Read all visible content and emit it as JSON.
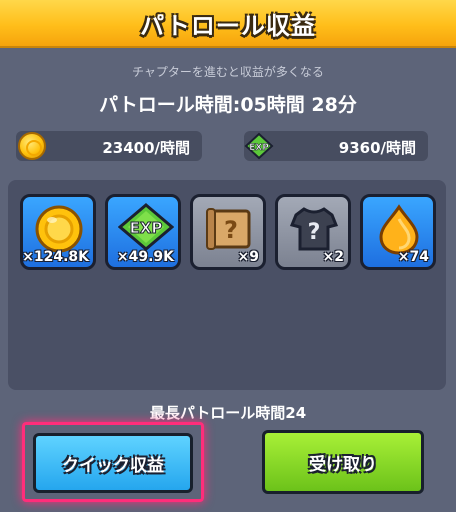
{
  "header": {
    "title": "パトロール収益"
  },
  "hint": "チャプターを進むと収益が多くなる",
  "patrol_time": "パトロール時間:05時間 28分",
  "rates": {
    "gold": "23400/時間",
    "exp": "9360/時間"
  },
  "rewards": [
    {
      "icon": "gold-coin-icon",
      "count": "×124.8K"
    },
    {
      "icon": "exp-gem-icon",
      "count": "×49.9K",
      "badge": "EXP"
    },
    {
      "icon": "mystery-scroll-icon",
      "count": "×9"
    },
    {
      "icon": "mystery-shirt-icon",
      "count": "×2"
    },
    {
      "icon": "fire-drop-icon",
      "count": "×74"
    }
  ],
  "max_patrol": "最長パトロール時間24",
  "buttons": {
    "quick": "クイック収益",
    "receive": "受け取り"
  },
  "colors": {
    "header_yellow": "#ffbe1a",
    "quick_blue": "#25a6ee",
    "receive_green": "#6cc21a",
    "highlight_pink": "#ff2d7a"
  }
}
